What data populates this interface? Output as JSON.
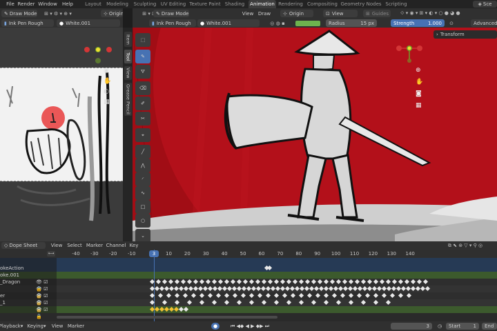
{
  "topbar": {
    "menus": [
      "File",
      "Render",
      "Window",
      "Help"
    ],
    "workspaces": [
      "Layout",
      "Modeling",
      "Sculpting",
      "UV Editing",
      "Texture Paint",
      "Shading",
      "Animation",
      "Rendering",
      "Compositing",
      "Geometry Nodes",
      "Scripting"
    ],
    "active_workspace": "Animation",
    "scene": "Sce"
  },
  "left": {
    "mode": "Draw Mode",
    "origin": "Origin",
    "brush": "Ink Pen Rough",
    "material": "White.001"
  },
  "main": {
    "menus": [
      "View",
      "Draw"
    ],
    "mode": "Draw Mode",
    "origin": "Origin",
    "view": "View",
    "guides": "Guides",
    "brush": "Ink Pen Rough",
    "material": "White.001",
    "radius_label": "Radius",
    "radius_value": "15 px",
    "strength_label": "Strength",
    "strength_value": "1.000",
    "advanced": "Advanced",
    "transform_panel": "Transform"
  },
  "side_tabs": [
    "Item",
    "Tool",
    "View",
    "Grease Pencil"
  ],
  "dope": {
    "editor": "Dope Sheet",
    "menus": [
      "View",
      "Select",
      "Marker",
      "Channel",
      "Key"
    ],
    "frame_ticks": [
      "-40",
      "-30",
      "-20",
      "-10",
      "0",
      "10",
      "20",
      "30",
      "40",
      "50",
      "60",
      "70",
      "80",
      "90",
      "100",
      "110",
      "120",
      "130",
      "140"
    ],
    "current_frame": "3",
    "channels": [
      "",
      "okeAction",
      "oke.001",
      "_Dragon",
      "",
      "er",
      "_1",
      ""
    ]
  },
  "bottom": {
    "menus": [
      "Playback",
      "Keying",
      "View",
      "Marker"
    ],
    "frame": "3",
    "start_label": "Start",
    "start_value": "1",
    "end_label": "End"
  },
  "colors": {
    "accent": "#4772b3",
    "red_bg": "#a10d15",
    "green_row": "#3c5a2d",
    "blue_row": "#263a55"
  }
}
